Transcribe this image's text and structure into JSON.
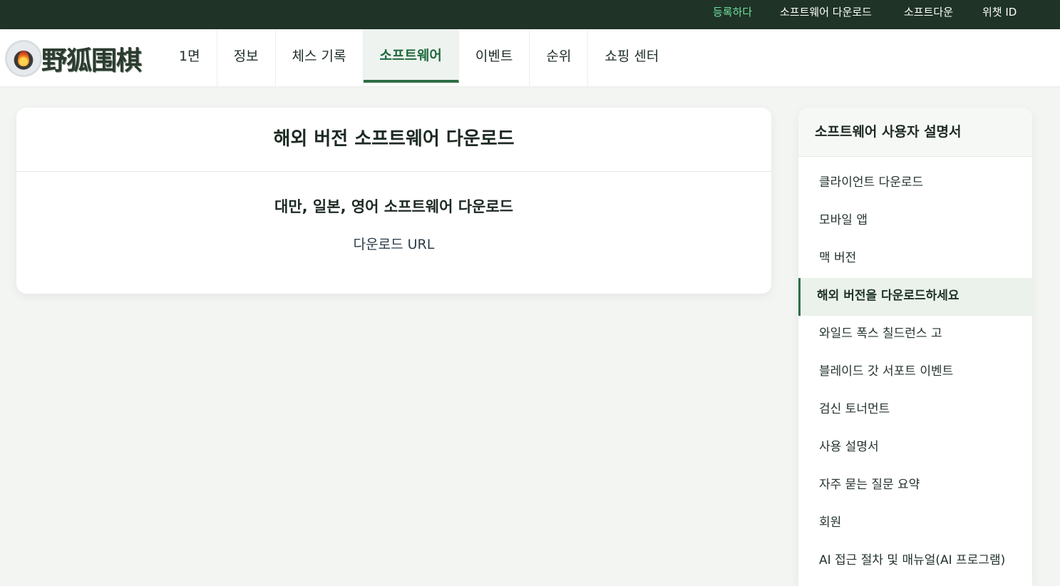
{
  "topbar": {
    "register": "등록하다",
    "software_download": "소프트웨어 다운로드",
    "software_down": "소프트다운",
    "wechat_id": "위챗 ID"
  },
  "header": {
    "logo_text": "野狐围棋",
    "nav": [
      {
        "label": "1면"
      },
      {
        "label": "정보"
      },
      {
        "label": "체스 기록"
      },
      {
        "label": "소프트웨어",
        "active": true
      },
      {
        "label": "이벤트"
      },
      {
        "label": "순위"
      },
      {
        "label": "쇼핑 센터"
      }
    ]
  },
  "main": {
    "title": "해외 버전 소프트웨어 다운로드",
    "subtitle": "대만, 일본, 영어 소프트웨어 다운로드",
    "link_label": "다운로드 URL"
  },
  "sidebar": {
    "title": "소프트웨어 사용자 설명서",
    "items": [
      {
        "label": "클라이언트 다운로드"
      },
      {
        "label": "모바일 앱"
      },
      {
        "label": "맥 버전"
      },
      {
        "label": "해외 버전을 다운로드하세요",
        "active": true
      },
      {
        "label": "와일드 폭스 칠드런스 고"
      },
      {
        "label": "블레이드 갓 서포트 이벤트"
      },
      {
        "label": "검신 토너먼트"
      },
      {
        "label": "사용 설명서"
      },
      {
        "label": "자주 묻는 질문 요약"
      },
      {
        "label": "회원"
      },
      {
        "label": "AI 접근 절차 및 매뉴얼(AI 프로그램)"
      }
    ]
  },
  "colors": {
    "topbar_bg": "#1f3326",
    "accent_green": "#2e6e45",
    "register_link": "#6fe0a0",
    "page_bg": "#f3f5f3"
  }
}
